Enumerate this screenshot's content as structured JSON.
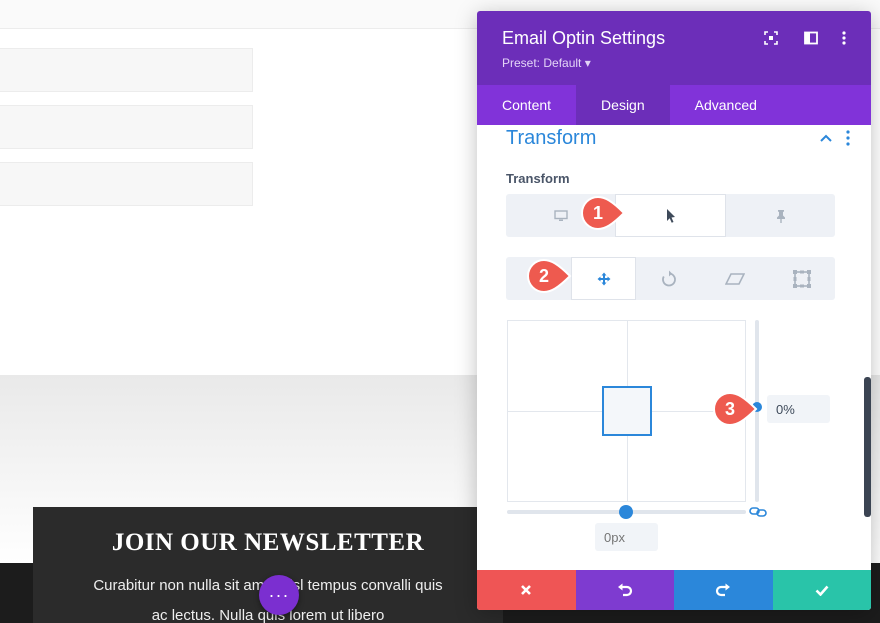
{
  "panel": {
    "title": "Email Optin Settings",
    "preset": "Preset: Default ▾",
    "header_icons": [
      "expand-icon",
      "split-view-icon",
      "more-vertical-icon"
    ]
  },
  "tabs": [
    {
      "label": "Content",
      "active": false
    },
    {
      "label": "Design",
      "active": true
    },
    {
      "label": "Advanced",
      "active": false
    }
  ],
  "section": {
    "title": "Transform",
    "field_label": "Transform",
    "state_tabs": [
      "desktop-icon",
      "hover-cursor-icon",
      "sticky-pin-icon"
    ],
    "active_state": "hover",
    "transform_tabs": [
      "move-icon",
      "rotate-icon",
      "skew-icon",
      "scale-icon"
    ],
    "active_transform": "move",
    "translate_y_value": "0%",
    "translate_x_placeholder": "0px"
  },
  "callouts": [
    "1",
    "2",
    "3"
  ],
  "footer": {
    "buttons": [
      "close-icon",
      "undo-icon",
      "redo-icon",
      "save-check-icon"
    ]
  },
  "background": {
    "newsletter_title": "JOIN OUR NEWSLETTER",
    "newsletter_line1": "Curabitur non nulla sit amet nisl tempus convalli quis",
    "newsletter_line2": "ac lectus. Nulla quis lorem ut libero",
    "fab_label": "···"
  },
  "colors": {
    "header_purple": "#6c2eb9",
    "tabs_purple": "#8133d9",
    "accent_blue": "#2b87da",
    "callout_red": "#ee5a4f",
    "footer_red": "#ef5555",
    "footer_purple": "#7e3bd0",
    "footer_blue": "#2b87da",
    "footer_green": "#29c4a9"
  }
}
